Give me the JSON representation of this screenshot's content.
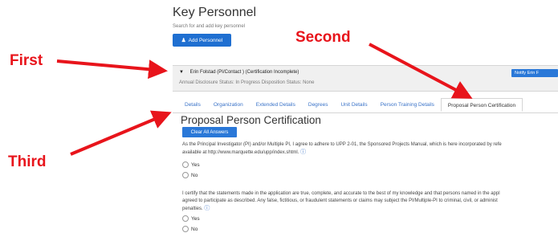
{
  "page": {
    "title": "Key Personnel",
    "subtitle": "Search for and add key personnel",
    "add_button": "Add Personnel"
  },
  "annotations": {
    "first": "First",
    "second": "Second",
    "third": "Third",
    "color": "#e8141b"
  },
  "person": {
    "name": "Erin Folstad (PI/Contact ) (Certification Incomplete)",
    "status": "Annual Disclosure Status: In Progress  Disposition Status: None",
    "notify_button": "Notify Erin F"
  },
  "tabs": [
    "Details",
    "Organization",
    "Extended Details",
    "Degrees",
    "Unit Details",
    "Person Training Details",
    "Proposal Person Certification"
  ],
  "active_tab": "Proposal Person Certification",
  "certification": {
    "title": "Proposal Person Certification",
    "clear_button": "Clear All Answers",
    "q1_line1": "As the Principal Investigator (PI) and/or Multiple PI, I agree to adhere to UPP 2-01, the Sponsored Projects Manual, which is here incorporated by refe",
    "q1_line2": "available at http://www.marquette.edu/upp/index.shtml.",
    "q2_line1": "I certify that the statements made in the application are true, complete, and accurate to the best of my knowledge and that persons named in the appl",
    "q2_line2": "agreed to participate as described. Any false, fictitious, or fraudulent statements or claims may subject the PI/Multiple-PI to criminal, civil, or administ",
    "q2_line3": "penalties.",
    "yes": "Yes",
    "no": "No",
    "info_icon": "info-icon"
  },
  "colors": {
    "primary_button": "#1f6fd1",
    "link": "#3a73c8"
  }
}
